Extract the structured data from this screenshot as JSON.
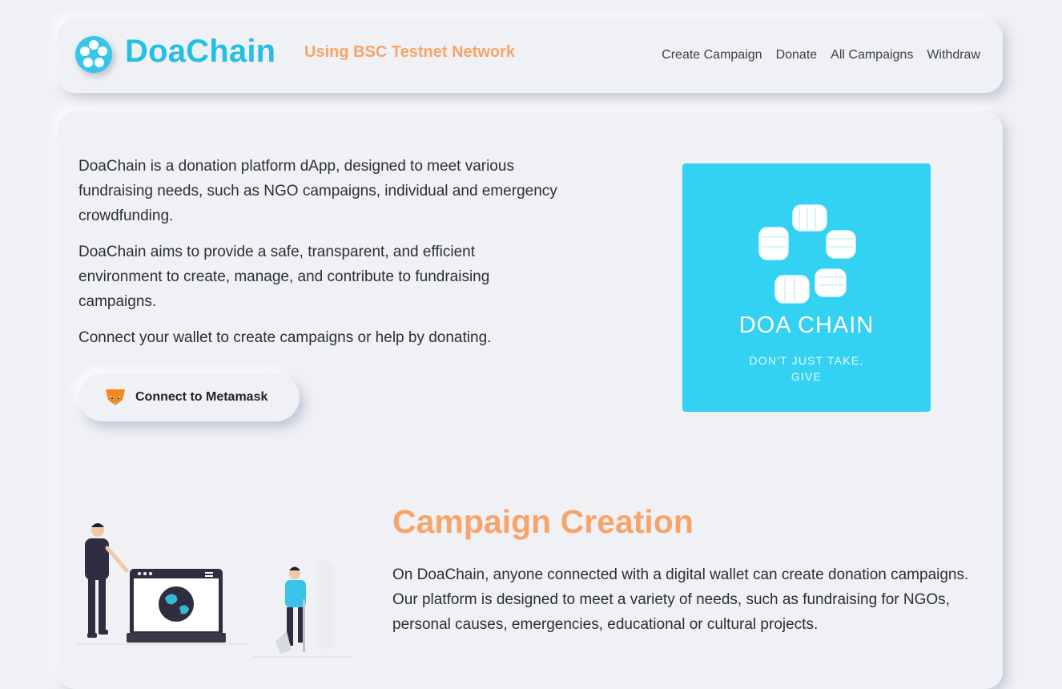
{
  "header": {
    "brand": "DoaChain",
    "network": "Using BSC Testnet Network",
    "nav": [
      "Create Campaign",
      "Donate",
      "All Campaigns",
      "Withdraw"
    ]
  },
  "intro": {
    "p1": "DoaChain is a donation platform dApp, designed to meet various fundraising needs, such as NGO campaigns, individual and emergency crowdfunding.",
    "p2": "DoaChain aims to provide a safe, transparent, and efficient environment to create, manage, and contribute to fundraising campaigns.",
    "p3": "Connect your wallet to create campaigns or help by donating.",
    "connect_button": "Connect to Metamask"
  },
  "promo": {
    "title": "DOA CHAIN",
    "tagline_line1": "DON'T JUST TAKE,",
    "tagline_line2": "GIVE",
    "bg_color": "#33d1f2"
  },
  "campaign_section": {
    "title": "Campaign Creation",
    "text": "On DoaChain, anyone connected with a digital wallet can create donation campaigns. Our platform is designed to meet a variety of needs, such as fundraising for NGOs, personal causes, emergencies, educational or cultural projects."
  },
  "colors": {
    "brand": "#24bfe3",
    "accent_orange": "#f7a46a",
    "background": "#f0f1f5"
  },
  "icons": [
    "doachain-logo-icon",
    "metamask-fox-icon",
    "hands-circle-icon"
  ]
}
